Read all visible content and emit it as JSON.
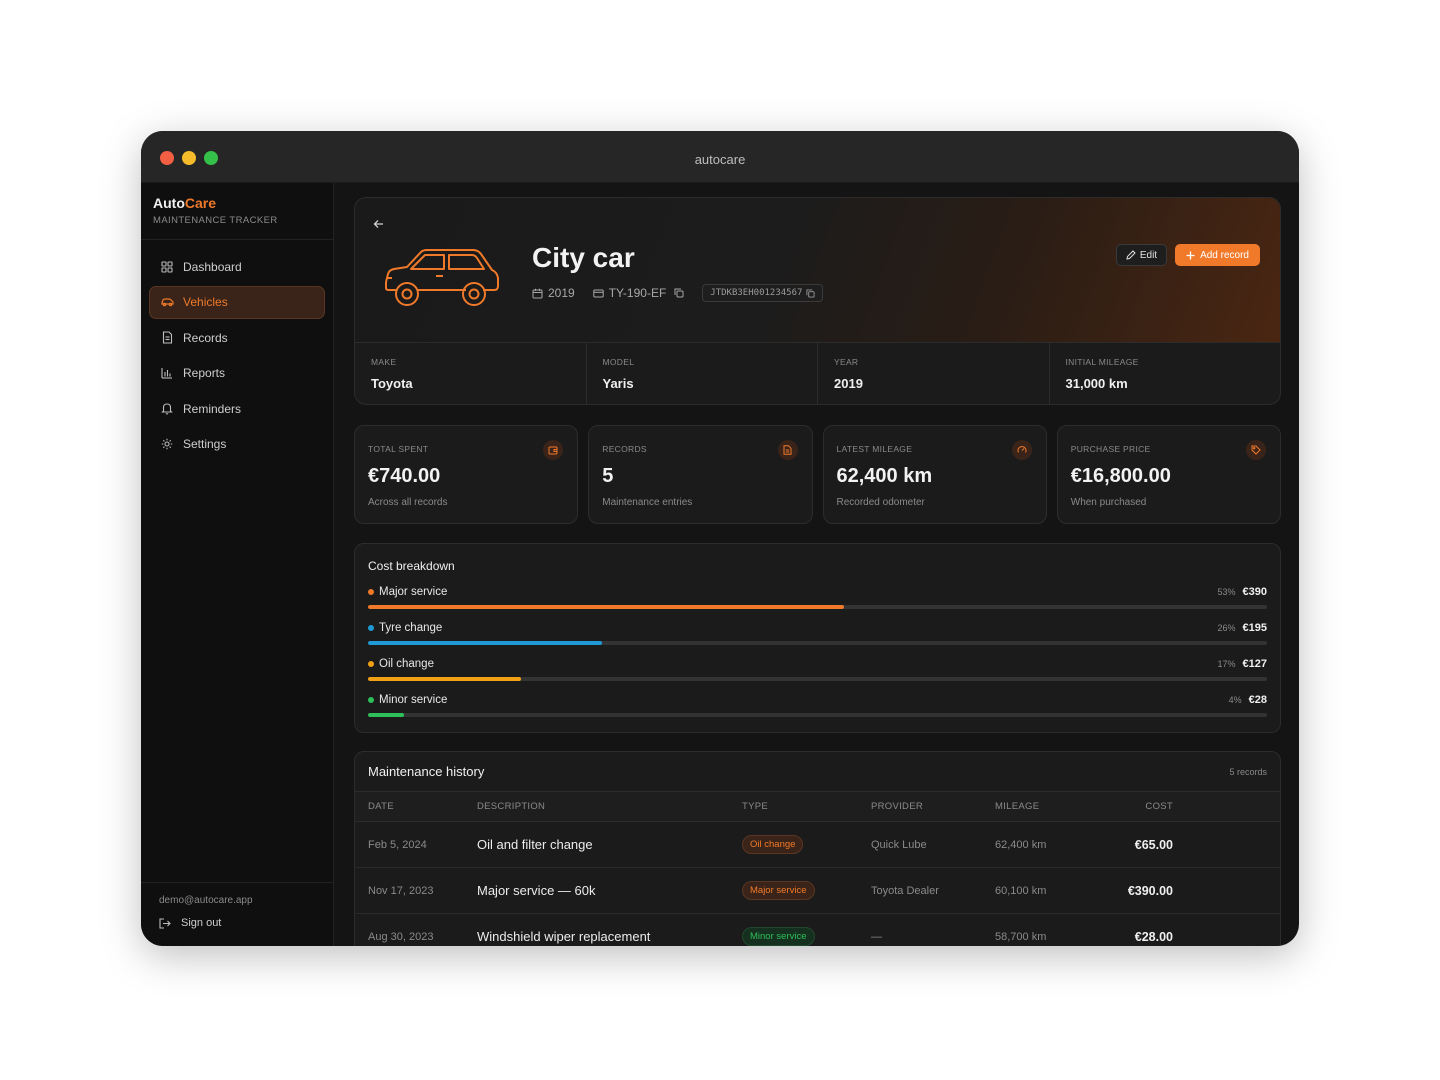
{
  "window": {
    "title": "autocare"
  },
  "brand": {
    "name_prefix": "Auto",
    "name_accent": "Care",
    "subtitle": "MAINTENANCE TRACKER"
  },
  "nav": [
    {
      "label": "Dashboard",
      "icon": "dashboard-icon"
    },
    {
      "label": "Vehicles",
      "icon": "car-icon",
      "active": true
    },
    {
      "label": "Records",
      "icon": "document-icon"
    },
    {
      "label": "Reports",
      "icon": "chart-icon"
    },
    {
      "label": "Reminders",
      "icon": "bell-icon"
    },
    {
      "label": "Settings",
      "icon": "gear-icon"
    }
  ],
  "user": {
    "email": "demo@autocare.app",
    "signout_label": "Sign out"
  },
  "vehicle": {
    "name": "City car",
    "year": "2019",
    "plate": "TY-190-EF",
    "vin": "JTDKB3EH001234567",
    "edit_label": "Edit",
    "add_label": "Add record"
  },
  "specs": [
    {
      "label": "MAKE",
      "value": "Toyota"
    },
    {
      "label": "MODEL",
      "value": "Yaris"
    },
    {
      "label": "YEAR",
      "value": "2019"
    },
    {
      "label": "INITIAL MILEAGE",
      "value": "31,000 km"
    }
  ],
  "stats": [
    {
      "label": "TOTAL SPENT",
      "value": "€740.00",
      "sub": "Across all records",
      "icon": "wallet-icon"
    },
    {
      "label": "RECORDS",
      "value": "5",
      "sub": "Maintenance entries",
      "icon": "document-icon"
    },
    {
      "label": "LATEST MILEAGE",
      "value": "62,400 km",
      "sub": "Recorded odometer",
      "icon": "gauge-icon"
    },
    {
      "label": "PURCHASE PRICE",
      "value": "€16,800.00",
      "sub": "When purchased",
      "icon": "tag-icon"
    }
  ],
  "breakdown": {
    "title": "Cost breakdown",
    "items": [
      {
        "label": "Major service",
        "pct": "53%",
        "amount": "€390",
        "fraction": 0.53,
        "color": "#f07a2a"
      },
      {
        "label": "Tyre change",
        "pct": "26%",
        "amount": "€195",
        "fraction": 0.26,
        "color": "#1f9ad6"
      },
      {
        "label": "Oil change",
        "pct": "17%",
        "amount": "€127",
        "fraction": 0.17,
        "color": "#f2a114"
      },
      {
        "label": "Minor service",
        "pct": "4%",
        "amount": "€28",
        "fraction": 0.04,
        "color": "#2fbf5a"
      }
    ]
  },
  "history": {
    "title": "Maintenance history",
    "count": "5 records",
    "columns": [
      "DATE",
      "DESCRIPTION",
      "TYPE",
      "PROVIDER",
      "MILEAGE",
      "COST"
    ],
    "rows": [
      {
        "date": "Feb 5, 2024",
        "desc": "Oil and filter change",
        "type": "Oil change",
        "type_style": "orange",
        "provider": "Quick Lube",
        "mileage": "62,400 km",
        "cost": "€65.00"
      },
      {
        "date": "Nov 17, 2023",
        "desc": "Major service — 60k",
        "type": "Major service",
        "type_style": "orange",
        "provider": "Toyota Dealer",
        "mileage": "60,100 km",
        "cost": "€390.00"
      },
      {
        "date": "Aug 30, 2023",
        "desc": "Windshield wiper replacement",
        "type": "Minor service",
        "type_style": "green",
        "provider": "—",
        "mileage": "58,700 km",
        "cost": "€28.00"
      }
    ]
  }
}
